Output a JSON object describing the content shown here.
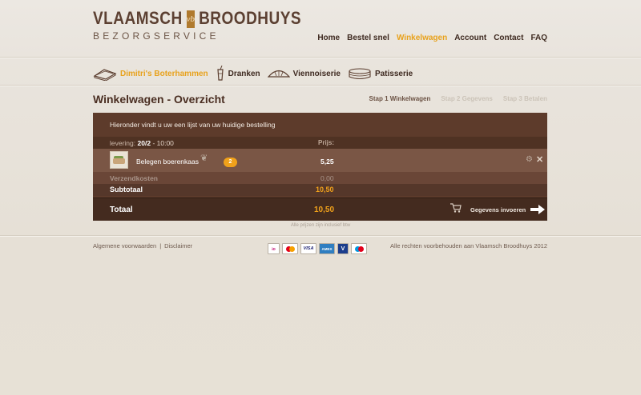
{
  "brand": {
    "name_left": "VLAAMSCH",
    "name_right": "BROODHUYS",
    "mark": "vb",
    "tagline": "BEZORGSERVICE"
  },
  "main_nav": [
    {
      "label": "Home",
      "active": false
    },
    {
      "label": "Bestel snel",
      "active": false
    },
    {
      "label": "Winkelwagen",
      "active": true
    },
    {
      "label": "Account",
      "active": false
    },
    {
      "label": "Contact",
      "active": false
    },
    {
      "label": "FAQ",
      "active": false
    }
  ],
  "categories": [
    {
      "label": "Dimitri's Boterhammen",
      "icon": "sandwich-icon",
      "active": true
    },
    {
      "label": "Dranken",
      "icon": "drink-icon",
      "active": false
    },
    {
      "label": "Viennoiserie",
      "icon": "croissant-icon",
      "active": false
    },
    {
      "label": "Patisserie",
      "icon": "cake-icon",
      "active": false
    }
  ],
  "page_title": "Winkelwagen - Overzicht",
  "steps": [
    {
      "label": "Stap 1 Winkelwagen",
      "active": true
    },
    {
      "label": "Stap 2 Gegevens",
      "active": false
    },
    {
      "label": "Stap 3 Betalen",
      "active": false
    }
  ],
  "cart": {
    "intro": "Hieronder vindt u uw een lijst van uw huidige bestelling",
    "delivery_label": "levering:",
    "delivery_date": "20/2",
    "delivery_time": "- 10:00",
    "price_header": "Prijs:",
    "items": [
      {
        "name": "Belegen boerenkaas",
        "quantity": "2",
        "price": "5,25",
        "vegetarian": true
      }
    ],
    "shipping_label": "Verzendkosten",
    "shipping_value": "0,00",
    "subtotal_label": "Subtotaal",
    "subtotal_value": "10,50",
    "total_label": "Totaal",
    "total_value": "10,50",
    "next_label": "Gegevens invoeren",
    "note": "Alle prijzen zijn inclusief btw"
  },
  "footer": {
    "terms": "Algemene voorwaarden",
    "separator": "|",
    "disclaimer": "Disclaimer",
    "copyright": "Alle rechten voorbehouden aan Vlaamsch Broodhuys 2012",
    "payment_methods": [
      "iDEAL",
      "MasterCard",
      "VISA",
      "American Express",
      "V PAY",
      "Maestro"
    ]
  },
  "colors": {
    "accent": "#e8a21c",
    "panel": "#5d3b2b",
    "text_dark": "#3e2a20"
  }
}
